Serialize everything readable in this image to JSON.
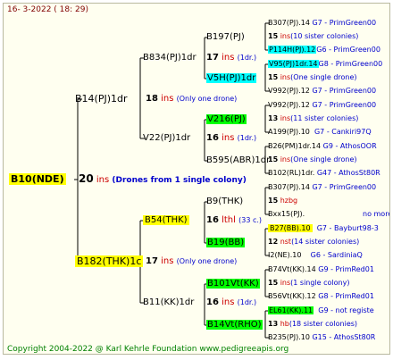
{
  "date_line": "16-  3-2022 (  18:  29)",
  "copyright": "Copyright 2004-2022 @ Karl Kehrle Foundation     www.pedigreeapis.org",
  "root": {
    "name": "B10(NDE)",
    "num": "20",
    "unit": "ins",
    "desc": "(Drones from 1 single colony)"
  },
  "gen1": [
    {
      "name": "B14(PJ)1dr",
      "num": "18",
      "unit": "ins",
      "desc": "(Only one drone)"
    },
    {
      "name": "B182(THK)1c",
      "num": "17",
      "unit": "ins",
      "desc": "(Only one drone)"
    }
  ],
  "gen2": [
    {
      "name": "B834(PJ)1dr",
      "num": "17",
      "unit": "ins",
      "desc": "(1dr.)"
    },
    {
      "name": "V22(PJ)1dr",
      "num": "16",
      "unit": "ins",
      "desc": "(1dr.)"
    },
    {
      "name": "B54(THK)",
      "num": "16",
      "unit": "lthl",
      "desc": "(33 c.)"
    },
    {
      "name": "B11(KK)1dr",
      "num": "16",
      "unit": "ins",
      "desc": "(1dr.)"
    }
  ],
  "gen3": [
    {
      "name": "B197(PJ)"
    },
    {
      "name": "V5H(PJ)1dr"
    },
    {
      "name": "V216(PJ)"
    },
    {
      "name": "B595(ABR)1dr"
    },
    {
      "name": "B9(THK)"
    },
    {
      "name": "B19(BB)"
    },
    {
      "name": "B101Vt(KK)"
    },
    {
      "name": "B14Vt(RHO)"
    }
  ],
  "gen4": [
    {
      "text": "B307(PJ).14",
      "note": "G7 - PrimGreen00"
    },
    {
      "num": "15",
      "unit": "ins",
      "note": "(10 sister colonies)"
    },
    {
      "text": "P114H(PJ).12",
      "note": "G6 - PrimGreen00"
    },
    {
      "text": "V95(PJ)1dr.14",
      "note": "G8 - PrimGreen00"
    },
    {
      "num": "15",
      "unit": "ins",
      "note": "(One single drone)"
    },
    {
      "text": "V992(PJ).12",
      "note": "G7 - PrimGreen00"
    },
    {
      "text": "V992(PJ).12",
      "note": "G7 - PrimGreen00"
    },
    {
      "num": "13",
      "unit": "ins",
      "note": "(11 sister colonies)"
    },
    {
      "text": "A199(PJ).10",
      "note": "G7 - Cankiri97Q"
    },
    {
      "text": "B26(PM)1dr.14",
      "note": "G9 - AthosOOR"
    },
    {
      "num": "15",
      "unit": "ins",
      "note": "(One single drone)"
    },
    {
      "text": "B102(RL)1dr.",
      "note": "G47 - AthosSt80R"
    },
    {
      "text": "B307(PJ).14",
      "note": "G7 - PrimGreen00"
    },
    {
      "num": "15",
      "unit": "hzbg",
      "note": ""
    },
    {
      "text": "Bxx15(PJ).",
      "note": "no more"
    },
    {
      "text": "B27(BB).10",
      "note": "G7 - Bayburt98-3"
    },
    {
      "num": "12",
      "unit": "nst",
      "note": "(14 sister colonies)"
    },
    {
      "text": "I2(NE).10",
      "note": "G6 - SardiniaQ"
    },
    {
      "text": "B74Vt(KK).14",
      "note": "G9 - PrimRed01"
    },
    {
      "num": "15",
      "unit": "ins",
      "note": "(1 single colony)"
    },
    {
      "text": "B56Vt(KK).12",
      "note": "G8 - PrimRed01"
    },
    {
      "text": "EL61(KK).11",
      "note": "G9 - not registe"
    },
    {
      "num": "13",
      "unit": "hb",
      "note": "(18 sister colonies)"
    },
    {
      "text": "B235(PJ).10",
      "note": "G15 - AthosSt80R"
    }
  ]
}
